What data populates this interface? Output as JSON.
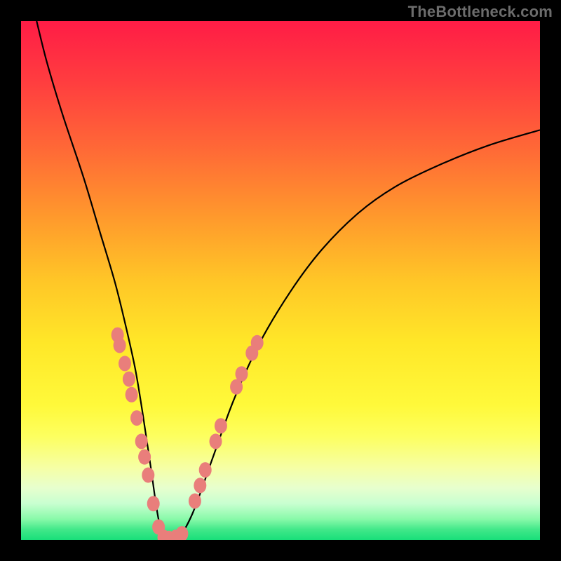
{
  "watermark": "TheBottleneck.com",
  "chart_data": {
    "type": "line",
    "title": "",
    "xlabel": "",
    "ylabel": "",
    "xlim": [
      0,
      100
    ],
    "ylim": [
      0,
      100
    ],
    "grid": false,
    "legend": false,
    "series": [
      {
        "name": "curve",
        "color": "#000000",
        "x": [
          3,
          5,
          8,
          12,
          15,
          18,
          20,
          22,
          23.5,
          25,
          26.5,
          28,
          30,
          33,
          37,
          41,
          46,
          52,
          58,
          65,
          72,
          80,
          90,
          100
        ],
        "y": [
          100,
          92,
          82,
          70,
          60,
          50,
          42,
          33,
          24,
          14,
          4,
          0,
          0,
          5,
          16,
          27,
          38,
          48,
          56,
          63,
          68,
          72,
          76,
          79
        ]
      }
    ],
    "markers": [
      {
        "x": 18.6,
        "y": 39.5
      },
      {
        "x": 19.0,
        "y": 37.5
      },
      {
        "x": 20.0,
        "y": 34.0
      },
      {
        "x": 20.8,
        "y": 31.0
      },
      {
        "x": 21.3,
        "y": 28.0
      },
      {
        "x": 22.3,
        "y": 23.5
      },
      {
        "x": 23.2,
        "y": 19.0
      },
      {
        "x": 23.8,
        "y": 16.0
      },
      {
        "x": 24.5,
        "y": 12.5
      },
      {
        "x": 25.5,
        "y": 7.0
      },
      {
        "x": 26.5,
        "y": 2.5
      },
      {
        "x": 27.5,
        "y": 0.5
      },
      {
        "x": 28.5,
        "y": 0.3
      },
      {
        "x": 29.8,
        "y": 0.5
      },
      {
        "x": 31.0,
        "y": 1.2
      },
      {
        "x": 33.5,
        "y": 7.5
      },
      {
        "x": 34.5,
        "y": 10.5
      },
      {
        "x": 35.5,
        "y": 13.5
      },
      {
        "x": 37.5,
        "y": 19.0
      },
      {
        "x": 38.5,
        "y": 22.0
      },
      {
        "x": 41.5,
        "y": 29.5
      },
      {
        "x": 42.5,
        "y": 32.0
      },
      {
        "x": 44.5,
        "y": 36.0
      },
      {
        "x": 45.5,
        "y": 38.0
      }
    ],
    "marker_color": "#e97e7b",
    "background": "rainbow-vertical-gradient"
  }
}
